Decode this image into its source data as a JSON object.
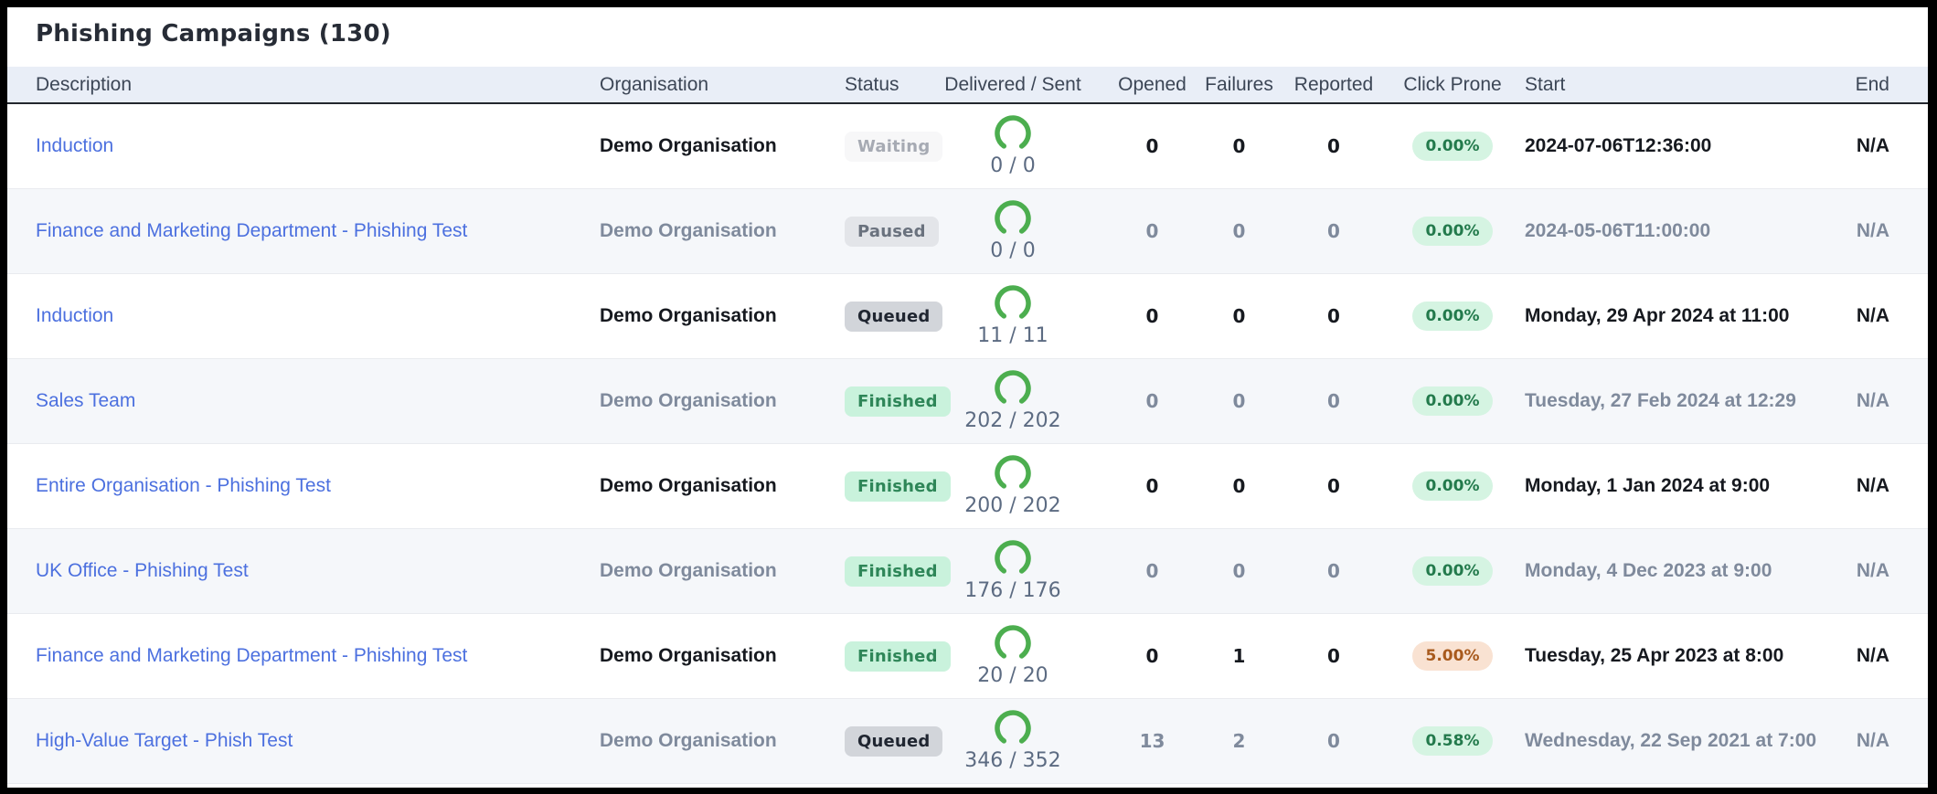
{
  "page": {
    "title": "Phishing Campaigns (130)"
  },
  "table": {
    "columns": [
      {
        "key": "description",
        "label": "Description"
      },
      {
        "key": "organisation",
        "label": "Organisation"
      },
      {
        "key": "status",
        "label": "Status"
      },
      {
        "key": "delivered",
        "label": "Delivered / Sent"
      },
      {
        "key": "opened",
        "label": "Opened"
      },
      {
        "key": "failures",
        "label": "Failures"
      },
      {
        "key": "reported",
        "label": "Reported"
      },
      {
        "key": "click_prone",
        "label": "Click Prone"
      },
      {
        "key": "start",
        "label": "Start"
      },
      {
        "key": "end",
        "label": "End"
      }
    ],
    "rows": [
      {
        "description": "Induction",
        "organisation": "Demo Organisation",
        "status": "Waiting",
        "status_variant": "waiting",
        "delivered": 0,
        "sent": 0,
        "opened": 0,
        "failures": 0,
        "reported": 0,
        "click_prone": "0.00%",
        "click_prone_variant": "green",
        "start": "2024-07-06T12:36:00",
        "end": "N/A"
      },
      {
        "description": "Finance and Marketing Department - Phishing Test",
        "organisation": "Demo Organisation",
        "status": "Paused",
        "status_variant": "paused",
        "delivered": 0,
        "sent": 0,
        "opened": 0,
        "failures": 0,
        "reported": 0,
        "click_prone": "0.00%",
        "click_prone_variant": "green",
        "start": "2024-05-06T11:00:00",
        "end": "N/A"
      },
      {
        "description": "Induction",
        "organisation": "Demo Organisation",
        "status": "Queued",
        "status_variant": "queued",
        "delivered": 11,
        "sent": 11,
        "opened": 0,
        "failures": 0,
        "reported": 0,
        "click_prone": "0.00%",
        "click_prone_variant": "green",
        "start": "Monday, 29 Apr 2024 at 11:00",
        "end": "N/A"
      },
      {
        "description": "Sales Team",
        "organisation": "Demo Organisation",
        "status": "Finished",
        "status_variant": "finished",
        "delivered": 202,
        "sent": 202,
        "opened": 0,
        "failures": 0,
        "reported": 0,
        "click_prone": "0.00%",
        "click_prone_variant": "green",
        "start": "Tuesday, 27 Feb 2024 at 12:29",
        "end": "N/A"
      },
      {
        "description": "Entire Organisation - Phishing Test",
        "organisation": "Demo Organisation",
        "status": "Finished",
        "status_variant": "finished",
        "delivered": 200,
        "sent": 202,
        "opened": 0,
        "failures": 0,
        "reported": 0,
        "click_prone": "0.00%",
        "click_prone_variant": "green",
        "start": "Monday, 1 Jan 2024 at 9:00",
        "end": "N/A"
      },
      {
        "description": "UK Office - Phishing Test",
        "organisation": "Demo Organisation",
        "status": "Finished",
        "status_variant": "finished",
        "delivered": 176,
        "sent": 176,
        "opened": 0,
        "failures": 0,
        "reported": 0,
        "click_prone": "0.00%",
        "click_prone_variant": "green",
        "start": "Monday, 4 Dec 2023 at 9:00",
        "end": "N/A"
      },
      {
        "description": "Finance and Marketing Department - Phishing Test",
        "organisation": "Demo Organisation",
        "status": "Finished",
        "status_variant": "finished",
        "delivered": 20,
        "sent": 20,
        "opened": 0,
        "failures": 1,
        "reported": 0,
        "click_prone": "5.00%",
        "click_prone_variant": "orange",
        "start": "Tuesday, 25 Apr 2023 at 8:00",
        "end": "N/A"
      },
      {
        "description": "High-Value Target - Phish Test",
        "organisation": "Demo Organisation",
        "status": "Queued",
        "status_variant": "queued",
        "delivered": 346,
        "sent": 352,
        "opened": 13,
        "failures": 2,
        "reported": 0,
        "click_prone": "0.58%",
        "click_prone_variant": "green",
        "start": "Wednesday, 22 Sep 2021 at 7:00",
        "end": "N/A"
      }
    ]
  },
  "colors": {
    "title_text": "#272c36",
    "link": "#4c70df",
    "header_bg": "#e9eef7",
    "header_text": "#3c4656",
    "header_border": "#23272e",
    "row_border": "#e9ebef",
    "row_alt_bg": "#f5f7fa",
    "text_dark": "#16191f",
    "text_muted": "#7f8a9c",
    "gauge_label": "#5c6b82",
    "accent_green": "#4cae4f",
    "badge_waiting_bg": "#f7f7f8",
    "badge_waiting_text": "#a6aab3",
    "badge_paused_bg": "#e3e5e9",
    "badge_paused_text": "#6a727e",
    "badge_queued_bg": "#d2d5da",
    "badge_queued_text": "#202631",
    "badge_finished_bg": "#c9f2dc",
    "badge_finished_text": "#2e8658",
    "pill_green_bg": "#d5f4e2",
    "pill_green_text": "#237a4c",
    "pill_orange_bg": "#f9e2d2",
    "pill_orange_text": "#a85a1d"
  }
}
